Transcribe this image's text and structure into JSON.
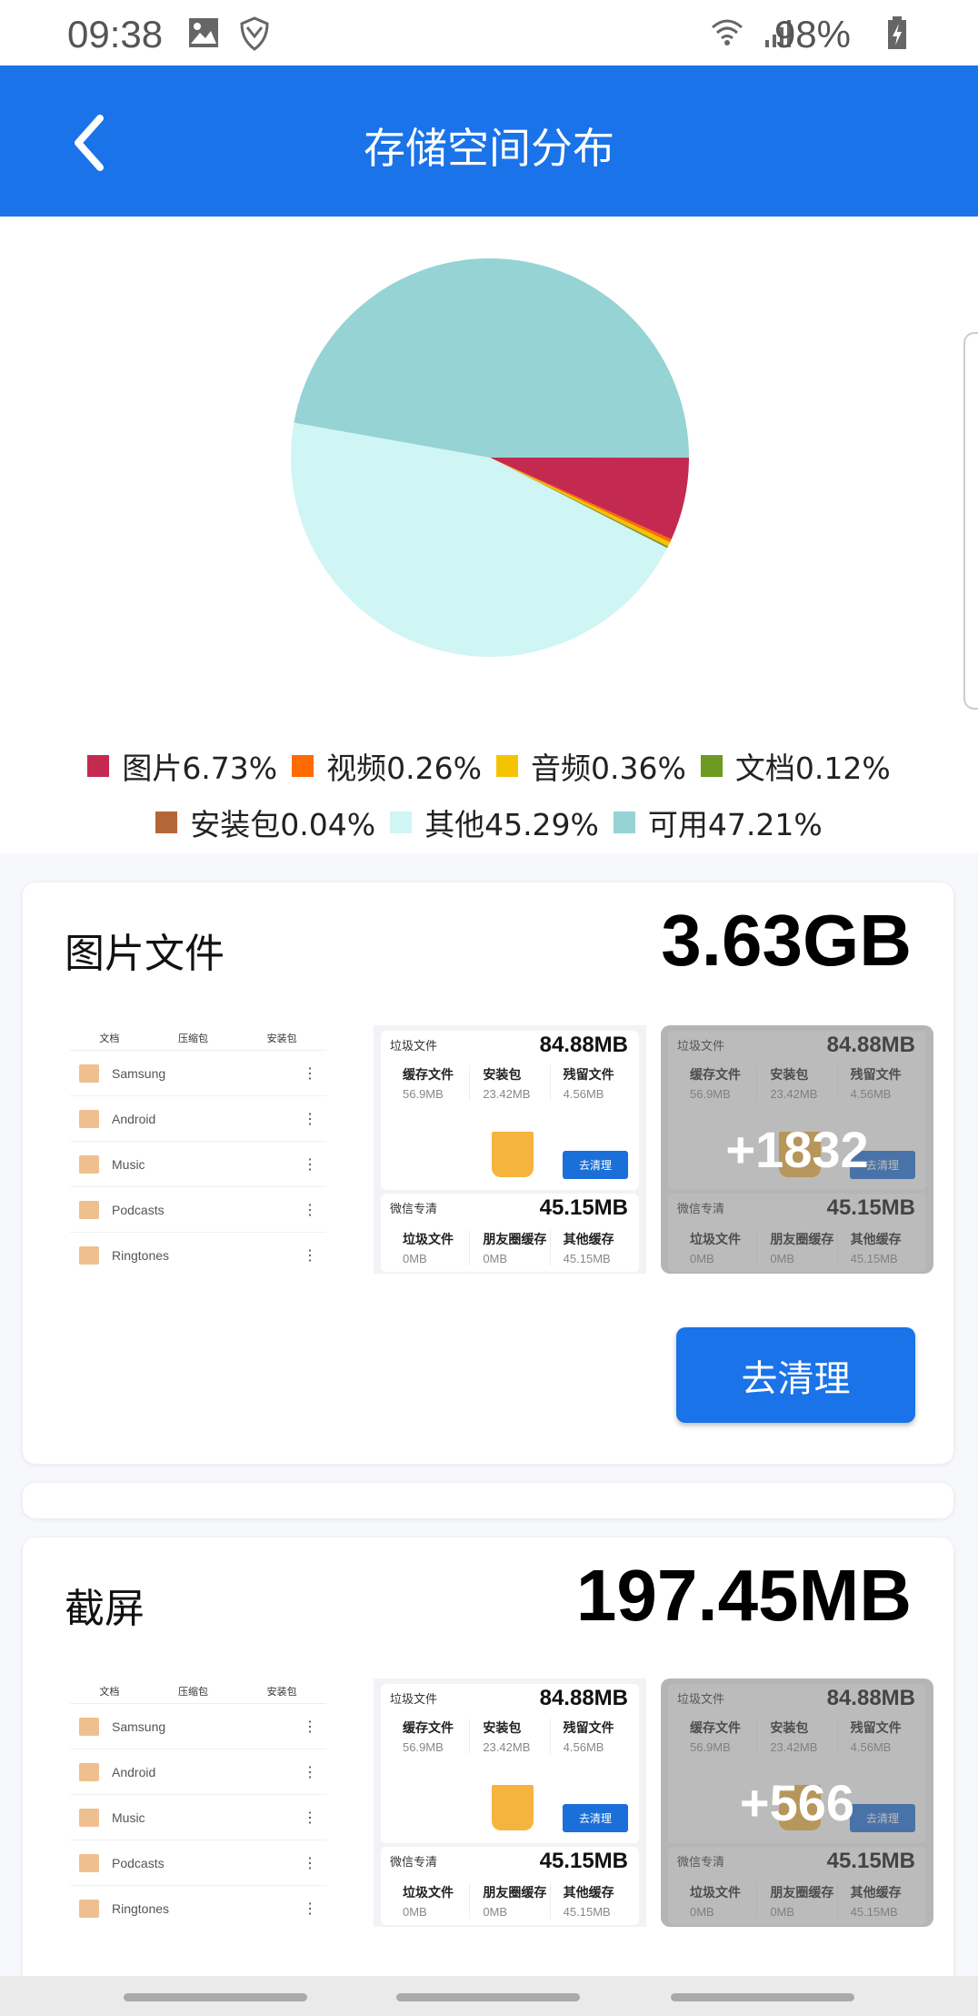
{
  "status": {
    "time": "09:38",
    "battery": "98%"
  },
  "appbar": {
    "title": "存储空间分布"
  },
  "chart_data": {
    "type": "pie",
    "slices": [
      {
        "label": "图片",
        "value": 6.73,
        "color": "#C42A50"
      },
      {
        "label": "视频",
        "value": 0.26,
        "color": "#FF6A00"
      },
      {
        "label": "音频",
        "value": 0.36,
        "color": "#F5C400"
      },
      {
        "label": "文档",
        "value": 0.12,
        "color": "#6E9A22"
      },
      {
        "label": "安装包",
        "value": 0.04,
        "color": "#B5653A"
      },
      {
        "label": "其他",
        "value": 45.29,
        "color": "#D0F5F5"
      },
      {
        "label": "可用",
        "value": 47.21,
        "color": "#96D3D4"
      }
    ],
    "legend": [
      "图片6.73%",
      "视频0.26%",
      "音频0.36%",
      "文档0.12%",
      "安装包0.04%",
      "其他45.29%",
      "可用47.21%"
    ]
  },
  "cards": [
    {
      "title": "图片文件",
      "value": "3.63GB",
      "more": "+1832",
      "button": "去清理"
    },
    {
      "title": "截屏",
      "value": "197.45MB",
      "more": "+566"
    }
  ],
  "thumb": {
    "tabs": [
      "文档",
      "压缩包",
      "安装包"
    ],
    "folders": [
      "Samsung",
      "Android",
      "Music",
      "Podcasts",
      "Ringtones"
    ],
    "junk": {
      "title": "垃圾文件",
      "value": "84.88MB",
      "items": [
        [
          "缓存文件",
          "56.9MB"
        ],
        [
          "安装包",
          "23.42MB"
        ],
        [
          "残留文件",
          "4.56MB"
        ]
      ],
      "button": "去清理"
    },
    "wechat": {
      "title": "微信专清",
      "value": "45.15MB",
      "items": [
        [
          "垃圾文件",
          "0MB"
        ],
        [
          "朋友圈缓存",
          "0MB"
        ],
        [
          "其他缓存",
          "45.15MB"
        ]
      ]
    }
  }
}
